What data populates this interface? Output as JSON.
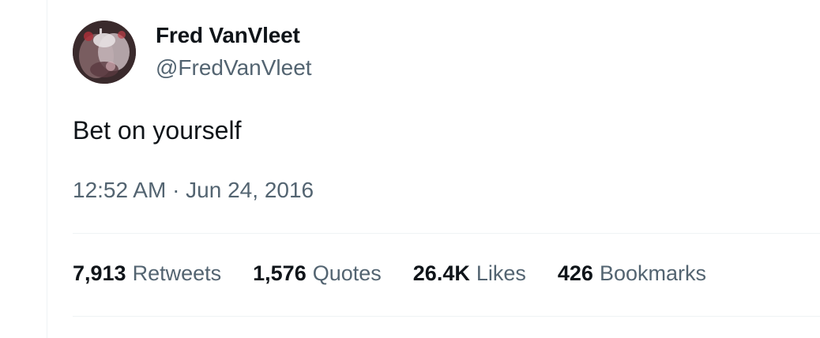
{
  "tweet": {
    "author": {
      "display_name": "Fred VanVleet",
      "handle": "@FredVanVleet"
    },
    "text": "Bet on yourself",
    "timestamp": "12:52 AM · Jun 24, 2016",
    "stats": [
      {
        "value": "7,913",
        "label": "Retweets"
      },
      {
        "value": "1,576",
        "label": "Quotes"
      },
      {
        "value": "26.4K",
        "label": "Likes"
      },
      {
        "value": "426",
        "label": "Bookmarks"
      }
    ]
  },
  "colors": {
    "primary_text": "#0f1419",
    "secondary_text": "#536471",
    "divider": "#eff3f4"
  }
}
